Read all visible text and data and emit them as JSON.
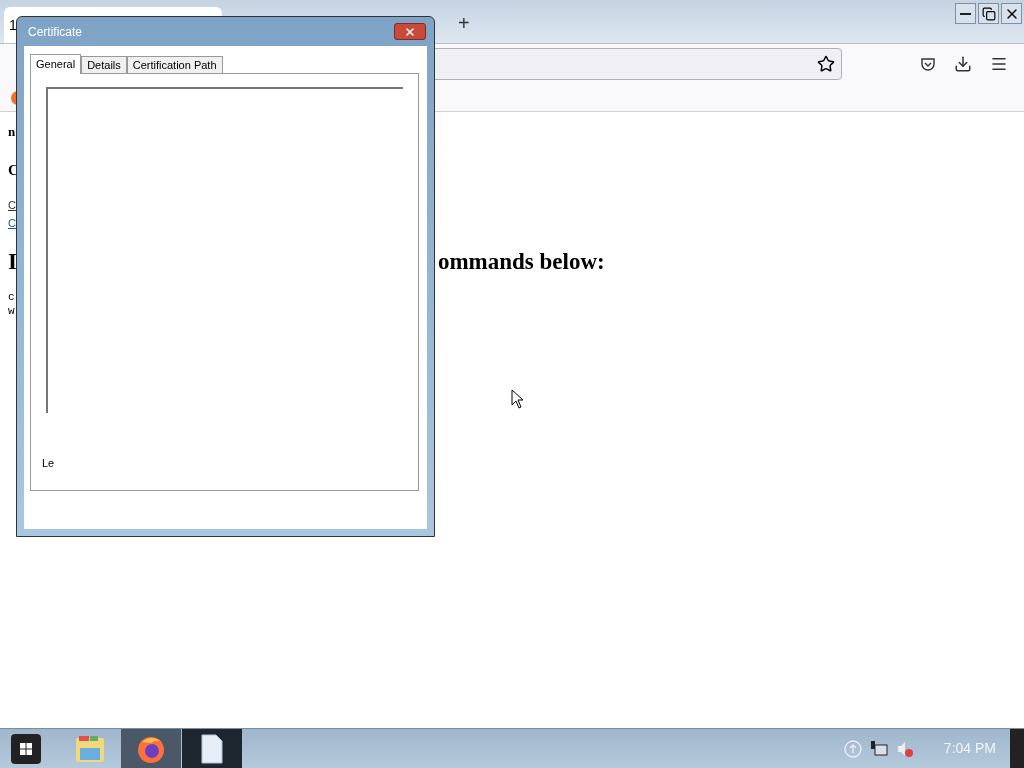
{
  "browser": {
    "tab_title": "1",
    "new_tab": "+"
  },
  "page": {
    "line_1": "n",
    "heading_1": "C",
    "links": [
      "C",
      "C"
    ],
    "heading_2_start": "I",
    "heading_2_end": "ommands below:",
    "code_lines": [
      "c",
      "w"
    ]
  },
  "dialog": {
    "title": "Certificate",
    "tabs": [
      {
        "label": "General",
        "selected": true
      },
      {
        "label": "Details",
        "selected": false
      },
      {
        "label": "Certification Path",
        "selected": false
      }
    ],
    "panel_text": "Le"
  },
  "taskbar": {
    "apps": [
      {
        "kind": "folder",
        "selected": false
      },
      {
        "kind": "firefox",
        "selected": true
      },
      {
        "kind": "document",
        "selected": false
      }
    ],
    "clock": "7:04 PM"
  }
}
